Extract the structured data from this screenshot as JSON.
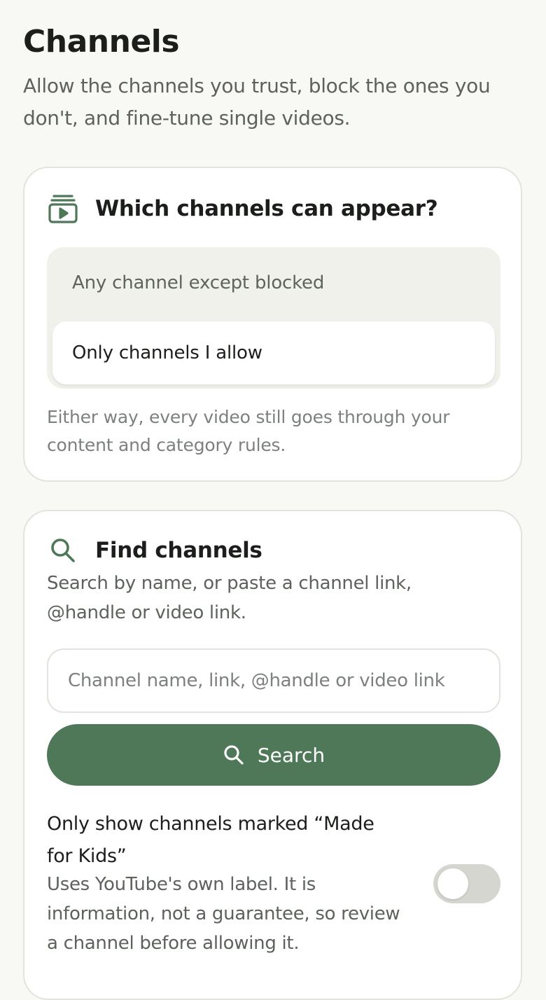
{
  "header": {
    "title": "Channels",
    "subtitle": "Allow the channels you trust, block the ones you don't, and fine-tune single videos."
  },
  "appearance_card": {
    "icon": "channel-stack-icon",
    "title": "Which channels can appear?",
    "options": [
      {
        "label": "Any channel except blocked",
        "selected": false
      },
      {
        "label": "Only channels I allow",
        "selected": true
      }
    ],
    "note": "Either way, every video still goes through your content and category rules."
  },
  "find_card": {
    "icon": "search-icon",
    "title": "Find channels",
    "description": "Search by name, or paste a channel link, @handle or video link.",
    "search_placeholder": "Channel name, link, @handle or video link",
    "search_value": "",
    "search_button_label": "Search",
    "kids_toggle": {
      "title": "Only show channels marked “Made for Kids”",
      "description": "Uses YouTube's own label. It is information, not a guarantee, so review a channel before allowing it.",
      "enabled": false
    }
  },
  "colors": {
    "accent": "#4f7859",
    "background": "#f8f8f4",
    "card": "#ffffff",
    "toggle_off": "#d6d6d0"
  }
}
